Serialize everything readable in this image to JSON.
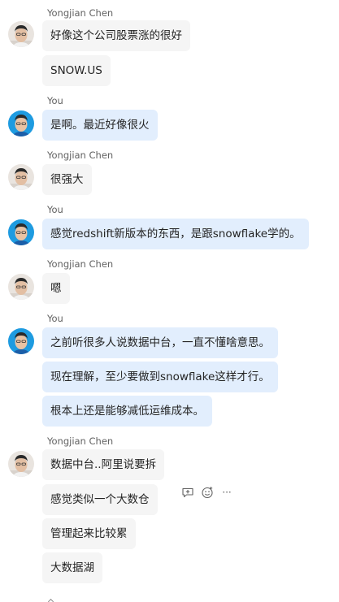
{
  "chat": {
    "groups": [
      {
        "sender": "Yongjian Chen",
        "avatar": "male-avatar-light",
        "messages": [
          "好像这个公司股票涨的很好",
          "SNOW.US"
        ]
      },
      {
        "sender": "You",
        "avatar": "male-avatar-blue",
        "messages": [
          "是啊。最近好像很火"
        ]
      },
      {
        "sender": "Yongjian Chen",
        "avatar": "male-avatar-light",
        "messages": [
          "很强大"
        ]
      },
      {
        "sender": "You",
        "avatar": "male-avatar-blue",
        "messages": [
          "感觉redshift新版本的东西，是跟snowflake学的。"
        ]
      },
      {
        "sender": "Yongjian Chen",
        "avatar": "male-avatar-light",
        "messages": [
          "嗯"
        ]
      },
      {
        "sender": "You",
        "avatar": "male-avatar-blue",
        "messages": [
          "之前听很多人说数据中台，一直不懂啥意思。",
          "现在理解，至少要做到snowflake这样才行。",
          "根本上还是能够减低运维成本。"
        ]
      },
      {
        "sender": "Yongjian Chen",
        "avatar": "male-avatar-light",
        "messages": [
          "数据中台..阿里说要拆",
          "感觉类似一个大数仓",
          "管理起来比较累",
          "大数据湖"
        ]
      }
    ],
    "hover_actions": {
      "icons": [
        "reply-icon",
        "emoji-icon",
        "more-options-icon"
      ],
      "more_label": "···"
    },
    "colors": {
      "my_bubble": "#e2eefd",
      "their_bubble": "#f5f5f5",
      "sender_text": "#616161"
    }
  }
}
